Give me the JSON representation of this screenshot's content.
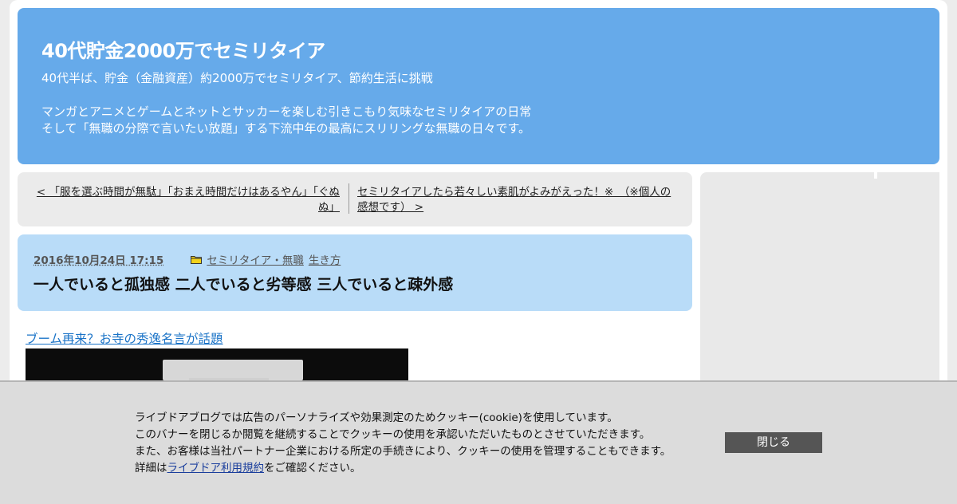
{
  "header": {
    "title": "40代貯金2000万でセミリタイア",
    "desc_line1": "40代半ば、貯金（金融資産）約2000万でセミリタイア、節約生活に挑戦",
    "desc_line2": "マンガとアニメとゲームとネットとサッカーを楽しむ引きこもり気味なセミリタイアの日常",
    "desc_line3": "そして「無職の分際で言いたい放題」する下流中年の最高にスリリングな無職の日々です。"
  },
  "pager": {
    "prev_label": "< 「服を選ぶ時間が無駄」「おまえ時間だけはあるやん」「ぐぬぬ」",
    "next_label": "セミリタイアしたら若々しい素肌がよみがえった！※　（※個人の感想です） >"
  },
  "entry": {
    "date": "2016年10月24日 17:15",
    "category1": "セミリタイア・無職",
    "category2": "生き方",
    "title": "一人でいると孤独感 二人でいると劣等感 三人でいると疎外感",
    "article_link": "ブーム再来？お寺の秀逸名言が話題"
  },
  "cookie": {
    "line1": "ライブドアブログでは広告のパーソナライズや効果測定のためクッキー(cookie)を使用しています。",
    "line2": "このバナーを閉じるか閲覧を継続することでクッキーの使用を承認いただいたものとさせていただきます。",
    "line3": "また、お客様は当社パートナー企業における所定の手続きにより、クッキーの使用を管理することもできます。",
    "line4_prefix": "詳細は",
    "line4_link": "ライブドア利用規約",
    "line4_suffix": "をご確認ください。",
    "close_label": "閉じる"
  },
  "colors": {
    "header_bg": "#66aaea",
    "entry_head_bg": "#b9dcf8",
    "link": "#1a73c7",
    "close_button_bg": "#555555"
  },
  "icons": {
    "category": "folder-icon"
  }
}
